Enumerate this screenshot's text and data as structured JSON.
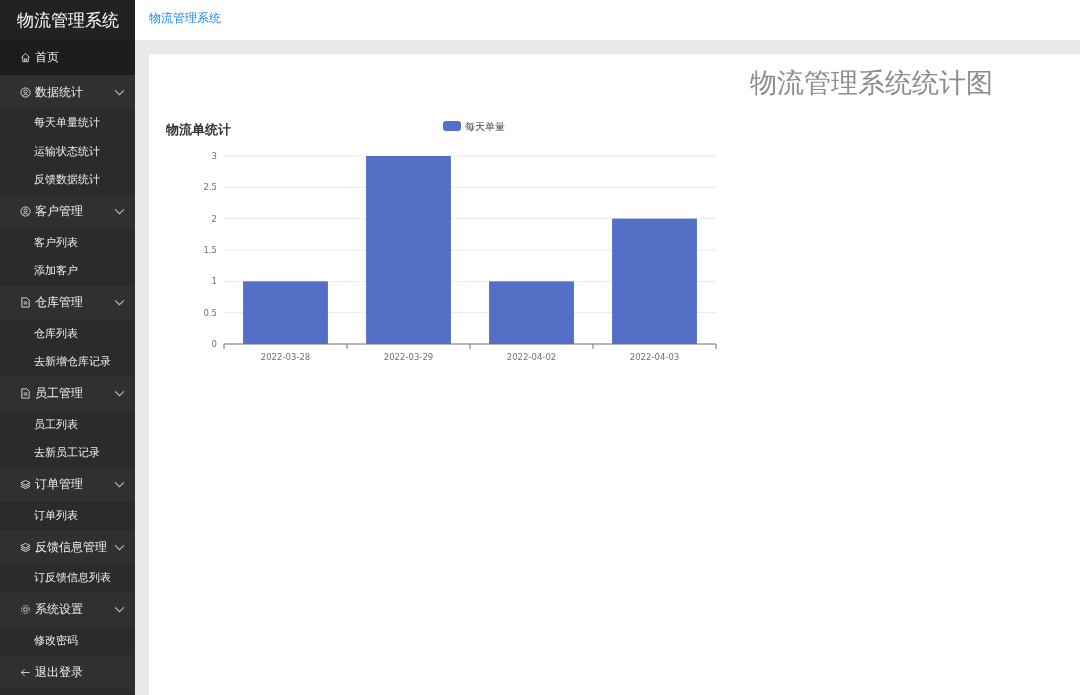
{
  "sidebar": {
    "logo": "物流管理系统",
    "items": [
      {
        "label": "首页",
        "selected": true
      },
      {
        "label": "数据统计",
        "expanded": true,
        "children": [
          {
            "label": "每天单量统计"
          },
          {
            "label": "运输状态统计"
          },
          {
            "label": "反馈数据统计"
          }
        ]
      },
      {
        "label": "客户管理",
        "expanded": true,
        "children": [
          {
            "label": "客户列表"
          },
          {
            "label": "添加客户"
          }
        ]
      },
      {
        "label": "仓库管理",
        "expanded": true,
        "children": [
          {
            "label": "仓库列表"
          },
          {
            "label": "去新增仓库记录"
          }
        ]
      },
      {
        "label": "员工管理",
        "expanded": true,
        "children": [
          {
            "label": "员工列表"
          },
          {
            "label": "去新员工记录"
          }
        ]
      },
      {
        "label": "订单管理",
        "expanded": true,
        "children": [
          {
            "label": "订单列表"
          }
        ]
      },
      {
        "label": "反馈信息管理",
        "expanded": true,
        "children": [
          {
            "label": "订反馈信息列表"
          }
        ]
      },
      {
        "label": "系统设置",
        "expanded": true,
        "children": [
          {
            "label": "修改密码"
          }
        ]
      },
      {
        "label": "退出登录",
        "selected": false
      }
    ]
  },
  "breadcrumb": "物流管理系统",
  "page_title": "物流管理系统统计图",
  "chart": {
    "chart_data": {
      "type": "bar",
      "title": "物流单统计",
      "categories": [
        "2022-03-28",
        "2022-03-29",
        "2022-04-02",
        "2022-04-03"
      ],
      "series": [
        {
          "name": "每天单量",
          "color": "#5470c6",
          "values": [
            1,
            3,
            1,
            2
          ]
        }
      ],
      "grid": true,
      "ylim": [
        0,
        3
      ],
      "yticks": [
        0,
        0.5,
        1,
        1.5,
        2,
        2.5,
        3
      ]
    }
  }
}
